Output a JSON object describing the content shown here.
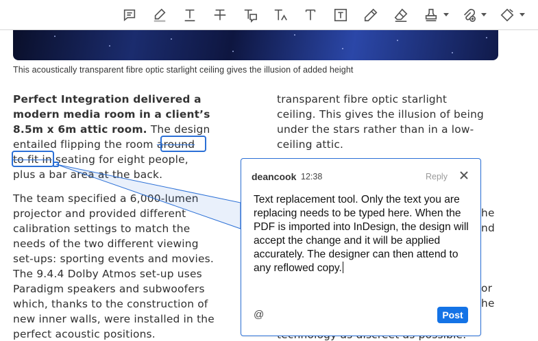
{
  "toolbar": {
    "tools": [
      {
        "name": "add-comment",
        "icon": "comment-icon"
      },
      {
        "name": "highlight-text",
        "icon": "highlighter-icon"
      },
      {
        "name": "underline-text",
        "icon": "underline-icon"
      },
      {
        "name": "strikethrough-text",
        "icon": "strikethrough-icon"
      },
      {
        "name": "replace-text",
        "icon": "replace-text-icon"
      },
      {
        "name": "insert-text",
        "icon": "insert-text-icon"
      },
      {
        "name": "add-text-comment",
        "icon": "text-icon"
      },
      {
        "name": "add-text-box",
        "icon": "text-box-icon"
      },
      {
        "name": "draw-freeform",
        "icon": "pencil-icon"
      },
      {
        "name": "erase",
        "icon": "eraser-icon"
      },
      {
        "name": "add-stamp",
        "icon": "stamp-icon"
      },
      {
        "name": "attach-file",
        "icon": "attach-file-icon"
      },
      {
        "name": "drawing-tools",
        "icon": "shapes-icon"
      }
    ],
    "accent_color": "#2a6fd6"
  },
  "document": {
    "caption": "This acoustically transparent fibre optic starlight ceiling gives the illusion of added height",
    "left_column": {
      "bold_lines": [
        "Perfect Integration delivered a",
        "modern media room in a client’s",
        "8.5m x 6m attic room."
      ],
      "line3_rest": " The design",
      "line4_pre": "entailed flipping the room ",
      "line4_strike": "around",
      "line5_strike": "to fit in",
      "line5_rest": " seating for eight people,",
      "line6": "plus a bar area at the back.",
      "paragraph2": [
        "The team specified a 6,000-lumen",
        "projector and provided different",
        "calibration settings to match the",
        "needs of the two different viewing",
        "set-ups: sporting events and movies.",
        "The 9.4.4 Dolby Atmos set-up uses",
        "Paradigm speakers and subwoofers",
        "which, thanks to the construction of",
        "new inner walls, were installed in the",
        "perfect acoustic positions."
      ]
    },
    "right_column": {
      "lines": [
        "transparent fibre optic starlight",
        "ceiling. This gives the illusion of being",
        "under the stars rather than in a low-",
        "ceiling attic."
      ],
      "partial_right": [
        "he",
        "nd",
        "",
        "",
        "",
        "or",
        "he"
      ],
      "bottom_line": "technology as discreet as possible."
    }
  },
  "comment": {
    "author": "deancook",
    "time": "12:38",
    "reply_label": "Reply",
    "body": "Text replacement tool. Only the text you are replacing needs to be typed here. When the PDF is imported into InDesign, the design will accept the change and it will be applied accurately. The designer can then attend to any reflowed copy.",
    "mention_symbol": "@",
    "post_label": "Post",
    "post_color": "#1473e6"
  }
}
